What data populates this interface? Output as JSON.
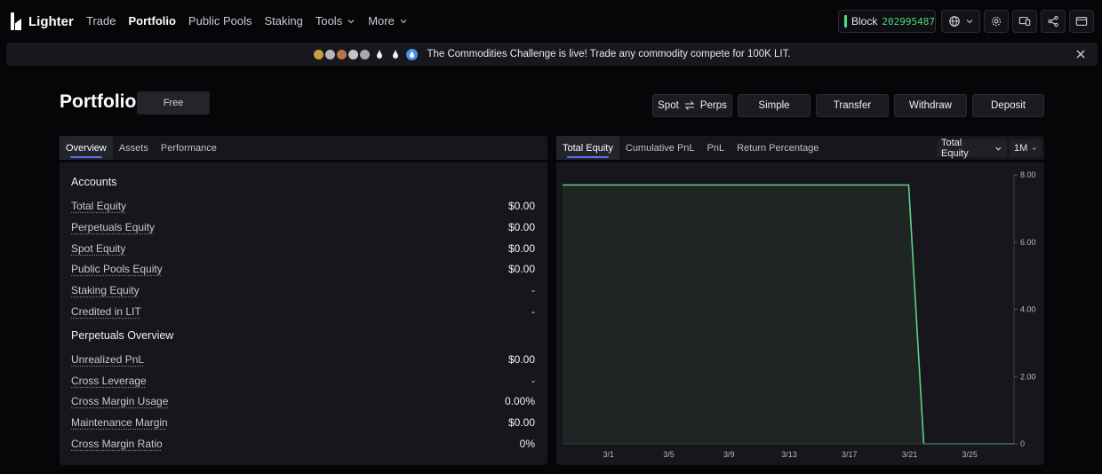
{
  "app": {
    "name": "Lighter"
  },
  "nav": [
    {
      "label": "Trade",
      "active": false
    },
    {
      "label": "Portfolio",
      "active": true
    },
    {
      "label": "Public Pools",
      "active": false
    },
    {
      "label": "Staking",
      "active": false
    },
    {
      "label": "Tools",
      "active": false,
      "dropdown": true
    },
    {
      "label": "More",
      "active": false,
      "dropdown": true
    }
  ],
  "header": {
    "block_label": "Block",
    "block_number": "202995487",
    "icons": [
      "globe-icon",
      "settings-icon",
      "devices-icon",
      "share-icon",
      "wallet-icon"
    ]
  },
  "banner": {
    "text": "The Commodities Challenge is live! Trade any commodity compete for 100K LIT.",
    "coin_colors": [
      "#c9a13b",
      "#b8b8b8",
      "#b87548",
      "#c4c4c4",
      "#a9a9a9"
    ]
  },
  "page": {
    "title": "Portfolio",
    "badge": "Free",
    "actions": {
      "spot": "Spot",
      "perps": "Perps",
      "simple": "Simple",
      "transfer": "Transfer",
      "withdraw": "Withdraw",
      "deposit": "Deposit"
    }
  },
  "left_tabs": [
    {
      "label": "Overview",
      "active": true
    },
    {
      "label": "Assets",
      "active": false
    },
    {
      "label": "Performance",
      "active": false
    }
  ],
  "accounts": {
    "title": "Accounts",
    "rows": [
      {
        "label": "Total Equity",
        "value": "$0.00"
      },
      {
        "label": "Perpetuals Equity",
        "value": "$0.00"
      },
      {
        "label": "Spot Equity",
        "value": "$0.00"
      },
      {
        "label": "Public Pools Equity",
        "value": "$0.00"
      },
      {
        "label": "Staking Equity",
        "value": "-"
      },
      {
        "label": "Credited in LIT",
        "value": "-"
      }
    ]
  },
  "perps_overview": {
    "title": "Perpetuals Overview",
    "rows": [
      {
        "label": "Unrealized PnL",
        "value": "$0.00"
      },
      {
        "label": "Cross Leverage",
        "value": "-"
      },
      {
        "label": "Cross Margin Usage",
        "value": "0.00%"
      },
      {
        "label": "Maintenance Margin",
        "value": "$0.00"
      },
      {
        "label": "Cross Margin Ratio",
        "value": "0%"
      }
    ]
  },
  "right_tabs": [
    {
      "label": "Total Equity",
      "active": true
    },
    {
      "label": "Cumulative PnL",
      "active": false
    },
    {
      "label": "PnL",
      "active": false
    },
    {
      "label": "Return Percentage",
      "active": false
    }
  ],
  "chart_controls": {
    "metric": "Total Equity",
    "range": "1M"
  },
  "chart_data": {
    "type": "area",
    "x_ticks": [
      "3/1",
      "3/5",
      "3/9",
      "3/13",
      "3/17",
      "3/21",
      "3/25"
    ],
    "y_ticks": [
      "0",
      "2.00",
      "4.00",
      "6.00",
      "8.00"
    ],
    "ylim": [
      0,
      8
    ],
    "x_day_range": [
      26,
      56
    ],
    "series": [
      {
        "values": [
          {
            "day": 26,
            "y": 7.7
          },
          {
            "day": 49,
            "y": 7.7
          },
          {
            "day": 50,
            "y": 0
          },
          {
            "day": 56,
            "y": 0
          }
        ]
      }
    ],
    "line_color": "#5fd08a"
  }
}
